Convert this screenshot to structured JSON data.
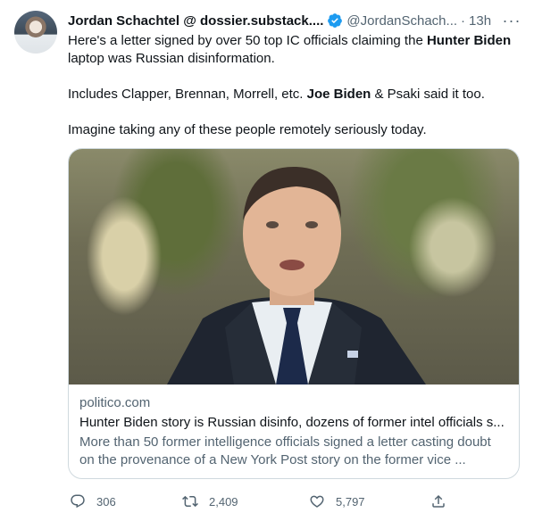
{
  "author": {
    "display_name": "Jordan Schachtel @ dossier.substack....",
    "handle": "@JordanSchach...",
    "separator": "·",
    "time": "13h"
  },
  "more_label": "···",
  "tweet": {
    "p1_a": "Here's a letter signed by over 50 top IC officials claiming the ",
    "p1_b": "Hunter Biden",
    "p1_c": " laptop was Russian disinformation.",
    "p2_a": "Includes Clapper, Brennan, Morrell, etc. ",
    "p2_b": "Joe Biden",
    "p2_c": " & Psaki said it too.",
    "p3": "Imagine taking any of these people remotely seriously today."
  },
  "card": {
    "domain": "politico.com",
    "title": "Hunter Biden story is Russian disinfo, dozens of former intel officials s...",
    "description": "More than 50 former intelligence officials signed a letter casting doubt on the provenance of a New York Post story on the former vice ..."
  },
  "actions": {
    "replies": "306",
    "retweets": "2,409",
    "likes": "5,797"
  },
  "colors": {
    "text": "#0f1419",
    "secondary": "#536471",
    "verified": "#1d9bf0",
    "border": "#cfd9de"
  }
}
